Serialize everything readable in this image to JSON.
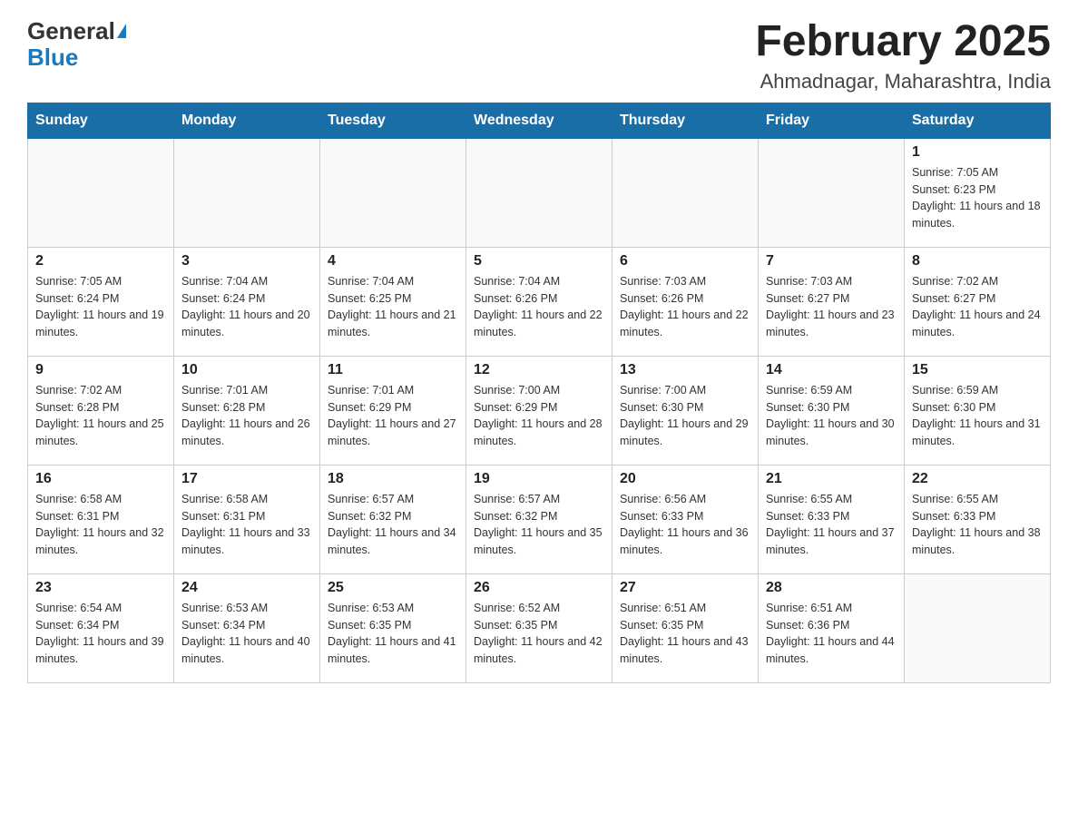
{
  "logo": {
    "general": "General",
    "blue": "Blue"
  },
  "header": {
    "title": "February 2025",
    "subtitle": "Ahmadnagar, Maharashtra, India"
  },
  "days_of_week": [
    "Sunday",
    "Monday",
    "Tuesday",
    "Wednesday",
    "Thursday",
    "Friday",
    "Saturday"
  ],
  "weeks": [
    [
      {
        "day": "",
        "info": ""
      },
      {
        "day": "",
        "info": ""
      },
      {
        "day": "",
        "info": ""
      },
      {
        "day": "",
        "info": ""
      },
      {
        "day": "",
        "info": ""
      },
      {
        "day": "",
        "info": ""
      },
      {
        "day": "1",
        "info": "Sunrise: 7:05 AM\nSunset: 6:23 PM\nDaylight: 11 hours and 18 minutes."
      }
    ],
    [
      {
        "day": "2",
        "info": "Sunrise: 7:05 AM\nSunset: 6:24 PM\nDaylight: 11 hours and 19 minutes."
      },
      {
        "day": "3",
        "info": "Sunrise: 7:04 AM\nSunset: 6:24 PM\nDaylight: 11 hours and 20 minutes."
      },
      {
        "day": "4",
        "info": "Sunrise: 7:04 AM\nSunset: 6:25 PM\nDaylight: 11 hours and 21 minutes."
      },
      {
        "day": "5",
        "info": "Sunrise: 7:04 AM\nSunset: 6:26 PM\nDaylight: 11 hours and 22 minutes."
      },
      {
        "day": "6",
        "info": "Sunrise: 7:03 AM\nSunset: 6:26 PM\nDaylight: 11 hours and 22 minutes."
      },
      {
        "day": "7",
        "info": "Sunrise: 7:03 AM\nSunset: 6:27 PM\nDaylight: 11 hours and 23 minutes."
      },
      {
        "day": "8",
        "info": "Sunrise: 7:02 AM\nSunset: 6:27 PM\nDaylight: 11 hours and 24 minutes."
      }
    ],
    [
      {
        "day": "9",
        "info": "Sunrise: 7:02 AM\nSunset: 6:28 PM\nDaylight: 11 hours and 25 minutes."
      },
      {
        "day": "10",
        "info": "Sunrise: 7:01 AM\nSunset: 6:28 PM\nDaylight: 11 hours and 26 minutes."
      },
      {
        "day": "11",
        "info": "Sunrise: 7:01 AM\nSunset: 6:29 PM\nDaylight: 11 hours and 27 minutes."
      },
      {
        "day": "12",
        "info": "Sunrise: 7:00 AM\nSunset: 6:29 PM\nDaylight: 11 hours and 28 minutes."
      },
      {
        "day": "13",
        "info": "Sunrise: 7:00 AM\nSunset: 6:30 PM\nDaylight: 11 hours and 29 minutes."
      },
      {
        "day": "14",
        "info": "Sunrise: 6:59 AM\nSunset: 6:30 PM\nDaylight: 11 hours and 30 minutes."
      },
      {
        "day": "15",
        "info": "Sunrise: 6:59 AM\nSunset: 6:30 PM\nDaylight: 11 hours and 31 minutes."
      }
    ],
    [
      {
        "day": "16",
        "info": "Sunrise: 6:58 AM\nSunset: 6:31 PM\nDaylight: 11 hours and 32 minutes."
      },
      {
        "day": "17",
        "info": "Sunrise: 6:58 AM\nSunset: 6:31 PM\nDaylight: 11 hours and 33 minutes."
      },
      {
        "day": "18",
        "info": "Sunrise: 6:57 AM\nSunset: 6:32 PM\nDaylight: 11 hours and 34 minutes."
      },
      {
        "day": "19",
        "info": "Sunrise: 6:57 AM\nSunset: 6:32 PM\nDaylight: 11 hours and 35 minutes."
      },
      {
        "day": "20",
        "info": "Sunrise: 6:56 AM\nSunset: 6:33 PM\nDaylight: 11 hours and 36 minutes."
      },
      {
        "day": "21",
        "info": "Sunrise: 6:55 AM\nSunset: 6:33 PM\nDaylight: 11 hours and 37 minutes."
      },
      {
        "day": "22",
        "info": "Sunrise: 6:55 AM\nSunset: 6:33 PM\nDaylight: 11 hours and 38 minutes."
      }
    ],
    [
      {
        "day": "23",
        "info": "Sunrise: 6:54 AM\nSunset: 6:34 PM\nDaylight: 11 hours and 39 minutes."
      },
      {
        "day": "24",
        "info": "Sunrise: 6:53 AM\nSunset: 6:34 PM\nDaylight: 11 hours and 40 minutes."
      },
      {
        "day": "25",
        "info": "Sunrise: 6:53 AM\nSunset: 6:35 PM\nDaylight: 11 hours and 41 minutes."
      },
      {
        "day": "26",
        "info": "Sunrise: 6:52 AM\nSunset: 6:35 PM\nDaylight: 11 hours and 42 minutes."
      },
      {
        "day": "27",
        "info": "Sunrise: 6:51 AM\nSunset: 6:35 PM\nDaylight: 11 hours and 43 minutes."
      },
      {
        "day": "28",
        "info": "Sunrise: 6:51 AM\nSunset: 6:36 PM\nDaylight: 11 hours and 44 minutes."
      },
      {
        "day": "",
        "info": ""
      }
    ]
  ]
}
